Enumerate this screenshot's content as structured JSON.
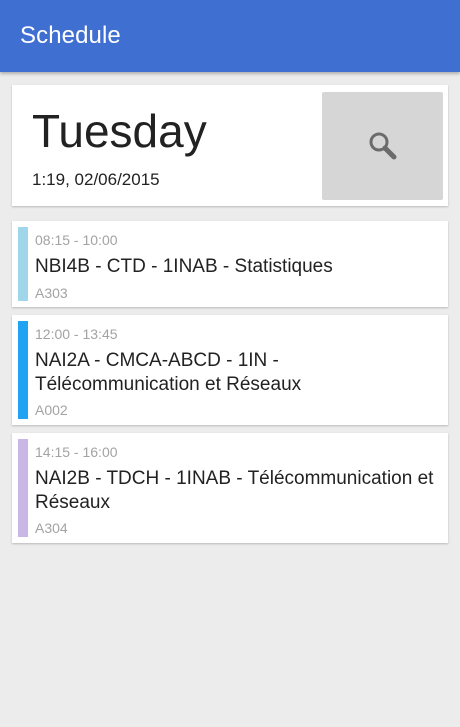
{
  "appbar": {
    "title": "Schedule"
  },
  "day": {
    "weekday": "Tuesday",
    "datetime": "1:19, 02/06/2015",
    "search_icon": "search-icon"
  },
  "entries": [
    {
      "time": "08:15 - 10:00",
      "title": "NBI4B - CTD - 1INAB - Statistiques",
      "room": "A303",
      "color": "#9fd6ea"
    },
    {
      "time": "12:00 - 13:45",
      "title": "NAI2A - CMCA-ABCD - 1IN - Télécommunication et Réseaux",
      "room": "A002",
      "color": "#20a3f3"
    },
    {
      "time": "14:15 - 16:00",
      "title": "NAI2B - TDCH - 1INAB - Télécommunication et Réseaux",
      "room": "A304",
      "color": "#c9b8e6"
    }
  ]
}
